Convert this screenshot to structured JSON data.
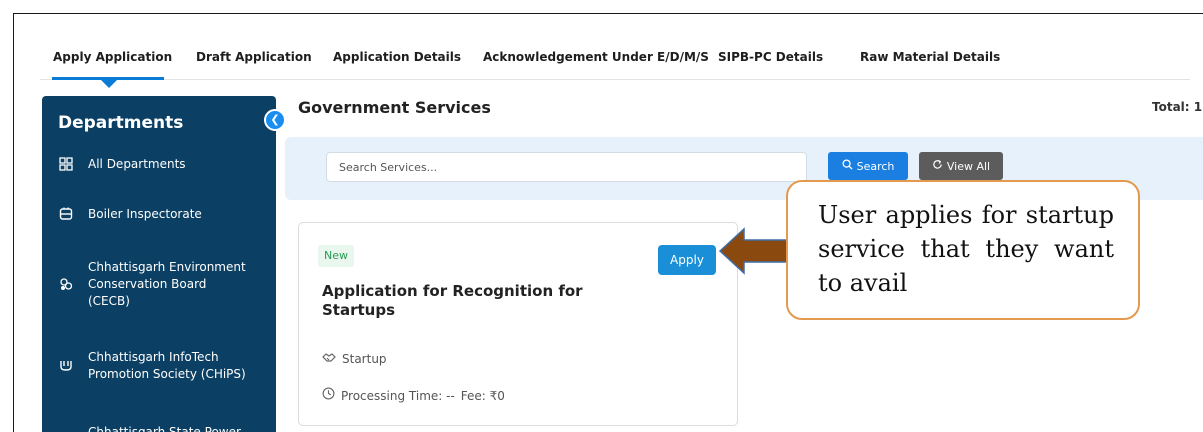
{
  "tabs": [
    {
      "label": "Apply Application",
      "active": true
    },
    {
      "label": "Draft Application"
    },
    {
      "label": "Application Details"
    },
    {
      "label": "Acknowledgement Under E/D/M/S"
    },
    {
      "label": "SIPB-PC Details"
    },
    {
      "label": "Raw Material Details"
    }
  ],
  "sidebar": {
    "title": "Departments",
    "collapse_icon": "chevron-left-icon",
    "items": [
      {
        "icon": "grid-icon",
        "label": "All Departments"
      },
      {
        "icon": "boiler-icon",
        "label": "Boiler Inspectorate"
      },
      {
        "icon": "environment-icon",
        "label": "Chhattisgarh Environment\nConservation Board\n(CECB)"
      },
      {
        "icon": "infotech-icon",
        "label": "Chhattisgarh InfoTech\nPromotion Society (CHiPS)"
      },
      {
        "icon": "power-icon",
        "label": "Chhattisgarh State Power"
      }
    ]
  },
  "main": {
    "title": "Government Services",
    "total": "Total: 1",
    "search": {
      "placeholder": "Search Services...",
      "search_label": "Search",
      "view_all_label": "View All"
    },
    "card": {
      "badge": "New",
      "apply_label": "Apply",
      "title": "Application for Recognition for Startups",
      "category": "Startup",
      "processing": "Processing Time: --",
      "fee": "Fee: ₹0"
    }
  },
  "callout": {
    "text": "User applies for startup service that they want to avail"
  },
  "colors": {
    "sidebar_bg": "#0b3f63",
    "accent": "#1a7fe0",
    "callout_border": "#e39a4f",
    "arrow_fill": "#8a4a0f"
  }
}
